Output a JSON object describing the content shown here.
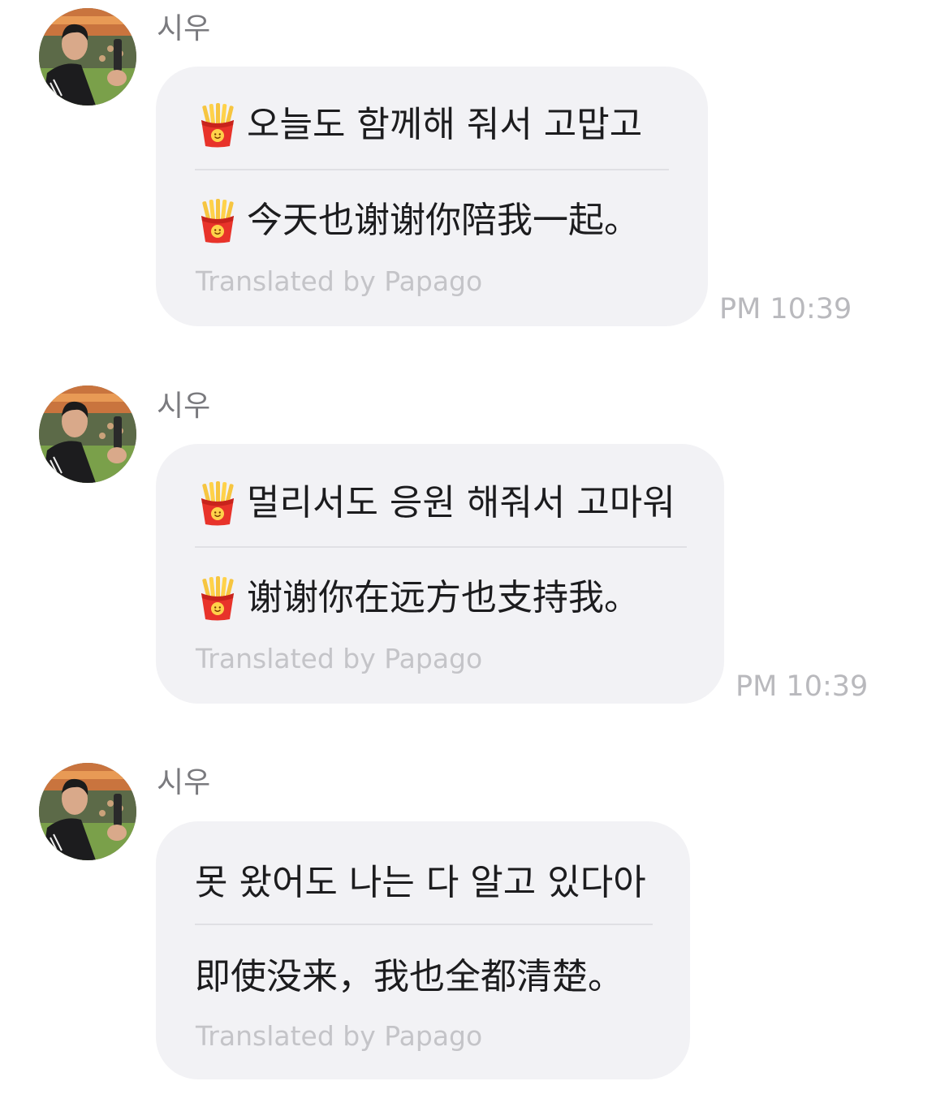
{
  "messages": [
    {
      "sender": "시우",
      "original": "오늘도 함께해 줘서 고맙고",
      "translation": "今天也谢谢你陪我一起。",
      "translated_by": "Translated by Papago",
      "time": "PM 10:39",
      "emoji": "french-fries"
    },
    {
      "sender": "시우",
      "original": "멀리서도 응원 해줘서 고마워",
      "translation": "谢谢你在远方也支持我。",
      "translated_by": "Translated by Papago",
      "time": "PM 10:39",
      "emoji": "french-fries"
    },
    {
      "sender": "시우",
      "original": "못 왔어도 나는 다 알고 있다아",
      "translation": "即使没来，我也全都清楚。",
      "translated_by": "Translated by Papago",
      "time": "",
      "emoji": ""
    }
  ],
  "colors": {
    "bubble": "#f2f2f5",
    "sender": "#7a7a7e",
    "text": "#1c1c1e",
    "muted": "#c4c4c8",
    "time": "#b9b9bd"
  }
}
